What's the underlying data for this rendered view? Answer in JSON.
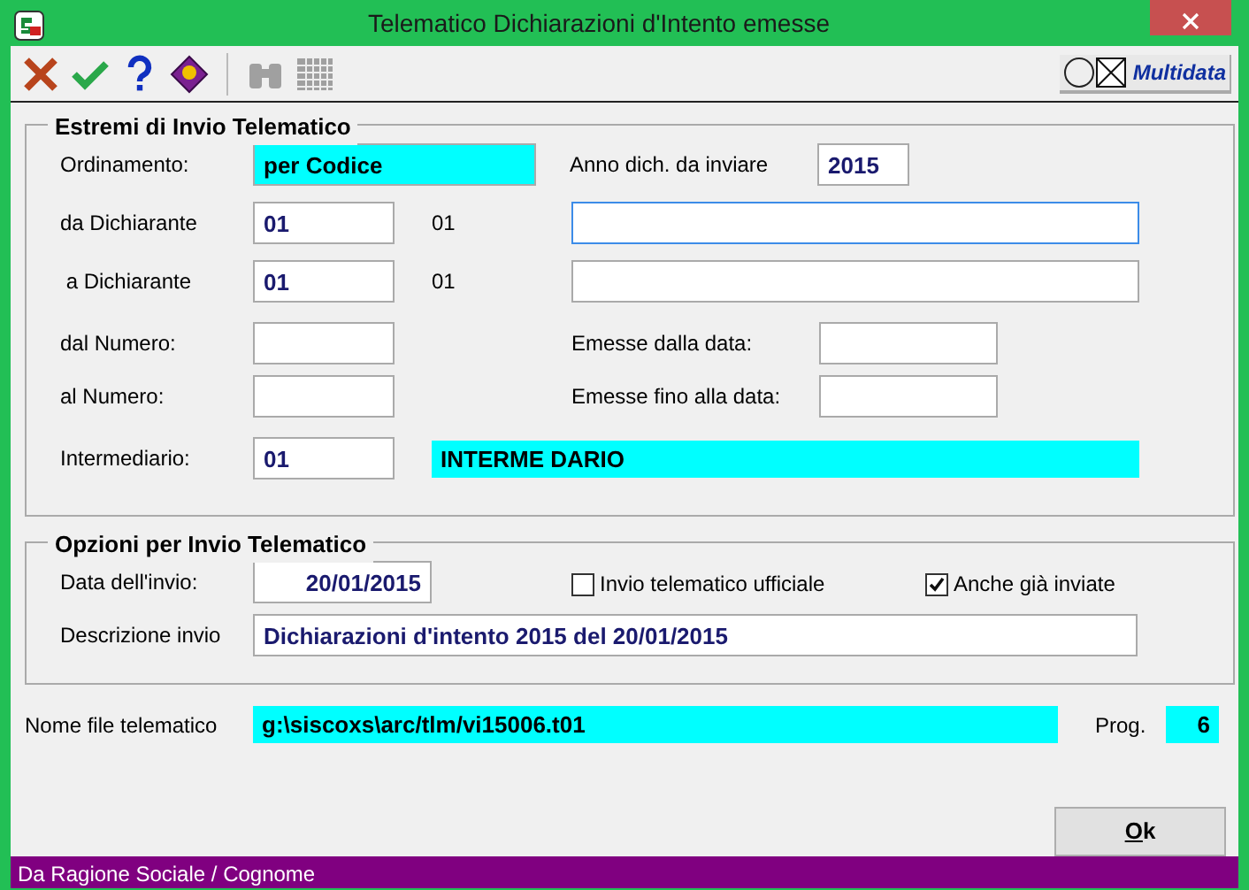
{
  "window": {
    "title": "Telematico Dichiarazioni d'Intento emesse"
  },
  "toolbar": {
    "buttons": [
      {
        "kind": "cancel",
        "disabled": false
      },
      {
        "kind": "confirm",
        "disabled": false
      },
      {
        "kind": "help",
        "disabled": false
      },
      {
        "kind": "book",
        "disabled": false
      },
      {
        "kind": "binoculars",
        "disabled": true
      },
      {
        "kind": "grid",
        "disabled": true
      }
    ],
    "brand": "Multidata"
  },
  "estremi": {
    "title": "Estremi di Invio Telematico",
    "ordinamento": {
      "label": "Ordinamento:",
      "value": "per Codice"
    },
    "anno": {
      "label": "Anno dich. da inviare",
      "value": "2015"
    },
    "dichiaranti": [
      {
        "label": "da Dichiarante",
        "code": "01",
        "code_echo": "01",
        "focused": true
      },
      {
        "label": " a Dichiarante",
        "code": "01",
        "code_echo": "01",
        "focused": false
      }
    ],
    "numeri": [
      {
        "label": "dal Numero:",
        "date_label": "Emesse dalla data:"
      },
      {
        "label": "al Numero:",
        "date_label": "Emesse fino alla data:"
      }
    ],
    "intermediario": {
      "label": "Intermediario:",
      "code": "01",
      "name": "INTERME DARIO"
    }
  },
  "opzioni": {
    "title": "Opzioni per Invio Telematico",
    "data_invio": {
      "label": "Data dell'invio:",
      "value": "20/01/2015"
    },
    "checkboxes": [
      {
        "label": "Invio telematico ufficiale",
        "checked": false
      },
      {
        "label": "Anche già inviate",
        "checked": true
      }
    ],
    "descrizione": {
      "label": "Descrizione invio",
      "value": "Dichiarazioni d'intento 2015 del 20/01/2015"
    }
  },
  "nome_file": {
    "label": "Nome file telematico",
    "value": "g:\\siscoxs\\arc/tlm/vi15006.t01"
  },
  "prog": {
    "label": "Prog.",
    "value": "6"
  },
  "ok_button": "Ok",
  "status_bar": "Da Ragione Sociale / Cognome"
}
